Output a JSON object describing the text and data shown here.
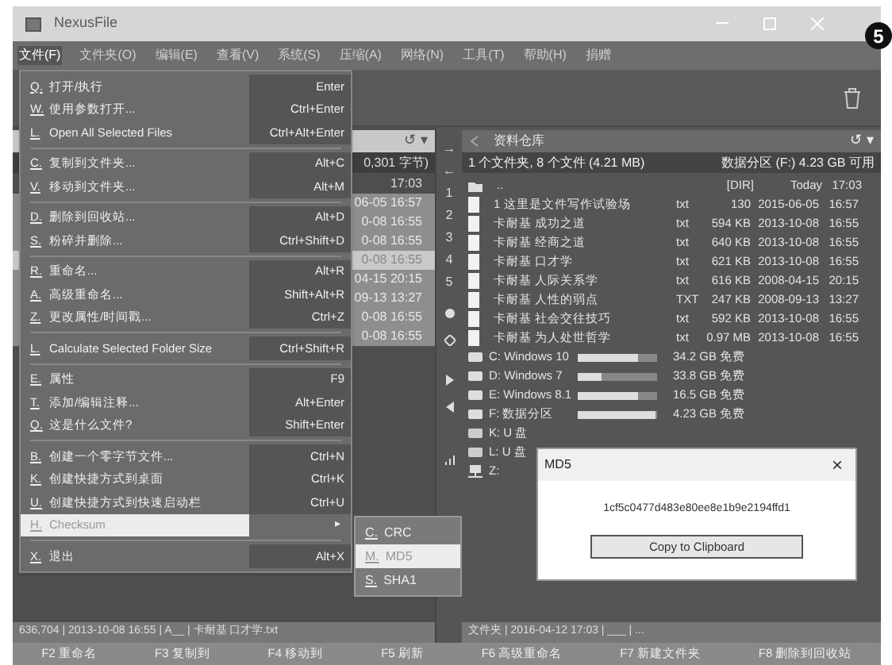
{
  "window": {
    "title": "NexusFile"
  },
  "callout": "5",
  "menubar": [
    {
      "label": "文件(F)",
      "selected": true
    },
    {
      "label": "文件夹(O)",
      "selected": false
    },
    {
      "label": "编辑(E)",
      "selected": false
    },
    {
      "label": "查看(V)",
      "selected": false
    },
    {
      "label": "系统(S)",
      "selected": false
    },
    {
      "label": "压缩(A)",
      "selected": false
    },
    {
      "label": "网络(N)",
      "selected": false
    },
    {
      "label": "工具(T)",
      "selected": false
    },
    {
      "label": "帮助(H)",
      "selected": false
    },
    {
      "label": "捐赠",
      "selected": false
    }
  ],
  "left_panel": {
    "header_icons": "↺ ▾",
    "summary": "0,301 字节)",
    "parent_time": "17:03",
    "rows": [
      {
        "time": "06-05 16:57",
        "selected": false
      },
      {
        "time": "0-08 16:55",
        "selected": false
      },
      {
        "time": "0-08 16:55",
        "selected": false
      },
      {
        "time": "0-08 16:55",
        "selected": true
      },
      {
        "time": "04-15 20:15",
        "selected": false
      },
      {
        "time": "09-13 13:27",
        "selected": false
      },
      {
        "time": "0-08 16:55",
        "selected": false
      },
      {
        "time": "0-08 16:55",
        "selected": false
      }
    ],
    "status": "636,704 | 2013-10-08 16:55 | A__ | 卡耐基 口才学.txt"
  },
  "strip": [
    "→",
    "←",
    "1",
    "2",
    "3",
    "4",
    "5"
  ],
  "right_panel": {
    "breadcrumb": "资料仓库",
    "header_icons": "↺ ▾",
    "summary": "1 个文件夹, 8 个文件 (4.21 MB)",
    "free": "数据分区 (F:) 4.23 GB 可用",
    "files": [
      {
        "kind": "parent",
        "name": "..",
        "size": "[DIR]",
        "date": "Today",
        "time": "17:03"
      },
      {
        "kind": "file",
        "name": "1 这里是文件写作试验场",
        "ext": "txt",
        "size": "130",
        "date": "2015-06-05",
        "time": "16:57"
      },
      {
        "kind": "file",
        "name": "卡耐基 成功之道",
        "ext": "txt",
        "size": "594 KB",
        "date": "2013-10-08",
        "time": "16:55"
      },
      {
        "kind": "file",
        "name": "卡耐基 经商之道",
        "ext": "txt",
        "size": "640 KB",
        "date": "2013-10-08",
        "time": "16:55"
      },
      {
        "kind": "file",
        "name": "卡耐基 口才学",
        "ext": "txt",
        "size": "621 KB",
        "date": "2013-10-08",
        "time": "16:55"
      },
      {
        "kind": "file",
        "name": "卡耐基 人际关系学",
        "ext": "txt",
        "size": "616 KB",
        "date": "2008-04-15",
        "time": "20:15"
      },
      {
        "kind": "file",
        "name": "卡耐基 人性的弱点",
        "ext": "TXT",
        "size": "247 KB",
        "date": "2008-09-13",
        "time": "13:27"
      },
      {
        "kind": "file",
        "name": "卡耐基 社会交往技巧",
        "ext": "txt",
        "size": "592 KB",
        "date": "2013-10-08",
        "time": "16:55"
      },
      {
        "kind": "file",
        "name": "卡耐基 为人处世哲学",
        "ext": "txt",
        "size": "0.97 MB",
        "date": "2013-10-08",
        "time": "16:55"
      }
    ],
    "drives": [
      {
        "kind": "disk",
        "name": "C: Windows 10",
        "level": 0.75,
        "free": "34.2 GB 免费"
      },
      {
        "kind": "disk",
        "name": "D: Windows 7",
        "level": 0.3,
        "free": "33.8 GB 免费"
      },
      {
        "kind": "disk",
        "name": "E: Windows 8.1",
        "level": 0.75,
        "free": "16.5 GB 免费"
      },
      {
        "kind": "disk",
        "name": "F: 数据分区",
        "level": 0.98,
        "free": "4.23 GB 免费"
      },
      {
        "kind": "usb",
        "name": "K: U 盘"
      },
      {
        "kind": "usb",
        "name": "L: U 盘"
      },
      {
        "kind": "network",
        "name": "Z:"
      }
    ],
    "status": "文件夹 | 2016-04-12 17:03 | ___ | ..."
  },
  "function_keys": [
    "F2 重命名",
    "F3 复制到",
    "F4 移动到",
    "F5 刷新",
    "F6 高级重命名",
    "F7 新建文件夹",
    "F8 删除到回收站"
  ],
  "file_menu": [
    {
      "kind": "item",
      "key": "Q.",
      "label": "打开/执行",
      "shortcut": "Enter",
      "selected": false
    },
    {
      "kind": "item",
      "key": "W.",
      "label": "使用参数打开...",
      "shortcut": "Ctrl+Enter",
      "selected": false
    },
    {
      "kind": "item",
      "key": "L.",
      "label": "Open All Selected Files",
      "shortcut": "Ctrl+Alt+Enter",
      "selected": false
    },
    {
      "kind": "separator"
    },
    {
      "kind": "item",
      "key": "C.",
      "label": "复制到文件夹...",
      "shortcut": "Alt+C",
      "selected": false
    },
    {
      "kind": "item",
      "key": "V.",
      "label": "移动到文件夹...",
      "shortcut": "Alt+M",
      "selected": false
    },
    {
      "kind": "separator"
    },
    {
      "kind": "item",
      "key": "D.",
      "label": "删除到回收站...",
      "shortcut": "Alt+D",
      "selected": false
    },
    {
      "kind": "item",
      "key": "S.",
      "label": "粉碎并删除...",
      "shortcut": "Ctrl+Shift+D",
      "selected": false
    },
    {
      "kind": "separator"
    },
    {
      "kind": "item",
      "key": "R.",
      "label": "重命名...",
      "shortcut": "Alt+R",
      "selected": false
    },
    {
      "kind": "item",
      "key": "A.",
      "label": "高级重命名...",
      "shortcut": "Shift+Alt+R",
      "selected": false
    },
    {
      "kind": "item",
      "key": "Z.",
      "label": "更改属性/时间戳...",
      "shortcut": "Ctrl+Z",
      "selected": false
    },
    {
      "kind": "separator"
    },
    {
      "kind": "item",
      "key": "L.",
      "label": "Calculate Selected Folder Size",
      "shortcut": "Ctrl+Shift+R",
      "selected": false
    },
    {
      "kind": "separator"
    },
    {
      "kind": "item",
      "key": "E.",
      "label": "属性",
      "shortcut": "F9",
      "selected": false
    },
    {
      "kind": "item",
      "key": "T.",
      "label": "添加/编辑注释...",
      "shortcut": "Alt+Enter",
      "selected": false
    },
    {
      "kind": "item",
      "key": "Q.",
      "label": "这是什么文件?",
      "shortcut": "Shift+Enter",
      "selected": false
    },
    {
      "kind": "separator"
    },
    {
      "kind": "item",
      "key": "B.",
      "label": "创建一个零字节文件...",
      "shortcut": "Ctrl+N",
      "selected": false
    },
    {
      "kind": "item",
      "key": "K.",
      "label": "创建快捷方式到桌面",
      "shortcut": "Ctrl+K",
      "selected": false
    },
    {
      "kind": "item",
      "key": "U.",
      "label": "创建快捷方式到快速启动栏",
      "shortcut": "Ctrl+U",
      "selected": false
    },
    {
      "kind": "submenu",
      "key": "H.",
      "label": "Checksum",
      "shortcut": "▸",
      "selected": true
    },
    {
      "kind": "separator"
    },
    {
      "kind": "item",
      "key": "X.",
      "label": "退出",
      "shortcut": "Alt+X",
      "selected": false
    }
  ],
  "checksum_menu": [
    {
      "key": "C.",
      "label": "CRC",
      "selected": false
    },
    {
      "key": "M.",
      "label": "MD5",
      "selected": true
    },
    {
      "key": "S.",
      "label": "SHA1",
      "selected": false
    }
  ],
  "dialog": {
    "title": "MD5",
    "close": "×",
    "hash": "1cf5c0477d483e80ee8e1b9e2194ffd1",
    "button": "Copy to Clipboard"
  }
}
